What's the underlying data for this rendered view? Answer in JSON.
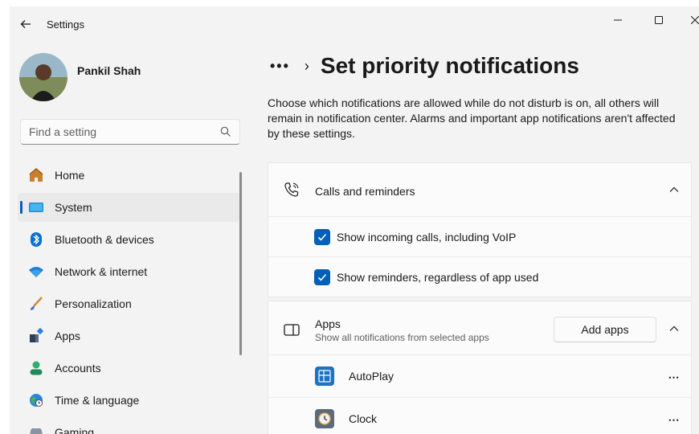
{
  "window": {
    "app_title": "Settings"
  },
  "profile": {
    "name": "Pankil Shah"
  },
  "search": {
    "placeholder": "Find a setting"
  },
  "sidebar": {
    "items": [
      {
        "label": "Home",
        "icon": "home-icon",
        "selected": false
      },
      {
        "label": "System",
        "icon": "system-icon",
        "selected": true
      },
      {
        "label": "Bluetooth & devices",
        "icon": "bluetooth-icon",
        "selected": false
      },
      {
        "label": "Network & internet",
        "icon": "wifi-icon",
        "selected": false
      },
      {
        "label": "Personalization",
        "icon": "brush-icon",
        "selected": false
      },
      {
        "label": "Apps",
        "icon": "apps-icon",
        "selected": false
      },
      {
        "label": "Accounts",
        "icon": "accounts-icon",
        "selected": false
      },
      {
        "label": "Time & language",
        "icon": "globe-icon",
        "selected": false
      },
      {
        "label": "Gaming",
        "icon": "gaming-icon",
        "selected": false
      }
    ]
  },
  "header": {
    "breadcrumb_more": "•••",
    "breadcrumb_sep": "›",
    "title": "Set priority notifications"
  },
  "description": "Choose which notifications are allowed while do not disturb is on, all others will remain in notification center. Alarms and important app notifications aren't affected by these settings.",
  "calls_card": {
    "title": "Calls and reminders",
    "options": [
      {
        "label": "Show incoming calls, including VoIP",
        "checked": true
      },
      {
        "label": "Show reminders, regardless of app used",
        "checked": true
      }
    ]
  },
  "apps_card": {
    "title": "Apps",
    "subtitle": "Show all notifications from selected apps",
    "add_button": "Add apps",
    "apps": [
      {
        "label": "AutoPlay",
        "icon": "autoplay-icon"
      },
      {
        "label": "Clock",
        "icon": "clock-icon"
      }
    ]
  },
  "colors": {
    "accent": "#005fb8",
    "background": "#f3f3f3",
    "card": "#fbfbfb"
  }
}
